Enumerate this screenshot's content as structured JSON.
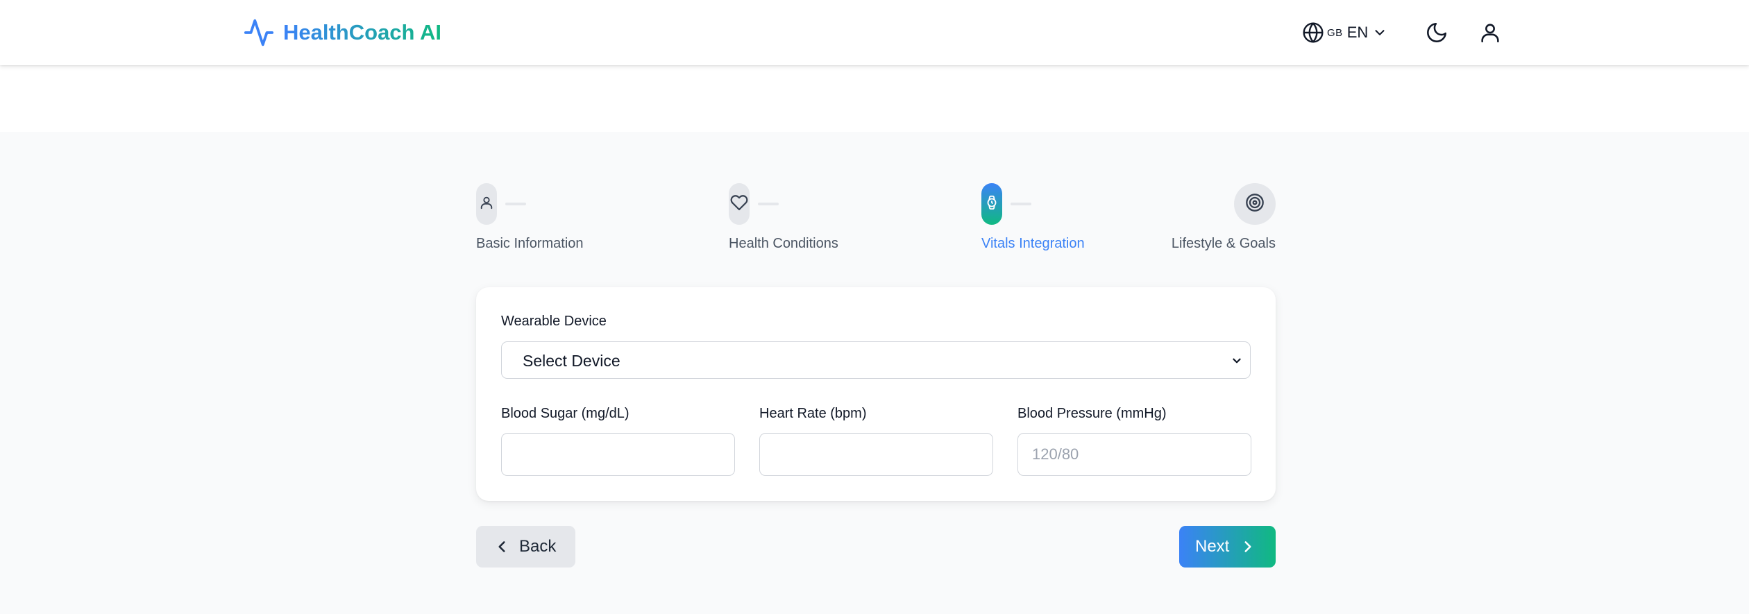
{
  "app": {
    "name": "HealthCoach AI",
    "brand_icon": "activity-pulse-icon",
    "brand_gradient": [
      "#3b82f6",
      "#10b981"
    ]
  },
  "header": {
    "language": {
      "flag": "GB",
      "code": "EN"
    },
    "icons": [
      "globe-icon",
      "chevron-down-icon",
      "moon-icon",
      "user-icon"
    ]
  },
  "stepper": {
    "steps": [
      {
        "label": "Basic Information",
        "icon": "user-icon",
        "state": "completed"
      },
      {
        "label": "Health Conditions",
        "icon": "heart-icon",
        "state": "completed"
      },
      {
        "label": "Vitals Integration",
        "icon": "watch-icon",
        "state": "active"
      },
      {
        "label": "Lifestyle & Goals",
        "icon": "target-icon",
        "state": "upcoming"
      }
    ],
    "active_color": "#3b82f6",
    "inactive_color": "#e5e7eb"
  },
  "form": {
    "wearable_device": {
      "label": "Wearable Device",
      "selected": "Select Device"
    },
    "blood_sugar": {
      "label": "Blood Sugar (mg/dL)",
      "value": "",
      "placeholder": ""
    },
    "heart_rate": {
      "label": "Heart Rate (bpm)",
      "value": "",
      "placeholder": ""
    },
    "blood_pressure": {
      "label": "Blood Pressure (mmHg)",
      "value": "",
      "placeholder": "120/80"
    }
  },
  "nav": {
    "back_label": "Back",
    "next_label": "Next"
  }
}
